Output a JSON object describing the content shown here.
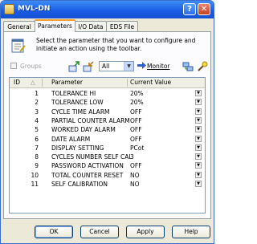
{
  "window": {
    "title": "MVL-DN",
    "help_btn": "?",
    "close_btn": "✕"
  },
  "tabs": [
    "General",
    "Parameters",
    "I/O Data",
    "EDS File"
  ],
  "active_tab": "Parameters",
  "info_text": "Select the parameter that you want to configure and initiate an action using the toolbar.",
  "toolbar": {
    "groups_label": "Groups",
    "filter_value": "All",
    "monitor_label": "Monitor"
  },
  "grid": {
    "columns": [
      "ID",
      "Parameter",
      "Current Value"
    ],
    "rows": [
      {
        "id": "1",
        "param": "TOLERANCE HI",
        "value": "20%"
      },
      {
        "id": "2",
        "param": "TOLERANCE LOW",
        "value": "20%"
      },
      {
        "id": "3",
        "param": "CYCLE TIME ALARM",
        "value": "OFF"
      },
      {
        "id": "4",
        "param": "PARTIAL COUNTER ALARM",
        "value": "OFF"
      },
      {
        "id": "5",
        "param": "WORKED DAY ALARM",
        "value": "OFF"
      },
      {
        "id": "6",
        "param": "DATE ALARM",
        "value": "OFF"
      },
      {
        "id": "7",
        "param": "DISPLAY SETTING",
        "value": "PCot"
      },
      {
        "id": "8",
        "param": "CYCLES NUMBER SELF CAL",
        "value": "3"
      },
      {
        "id": "9",
        "param": "PASSWORD ACTIVATION",
        "value": "OFF"
      },
      {
        "id": "10",
        "param": "TOTAL COUNTER RESET",
        "value": "NO"
      },
      {
        "id": "11",
        "param": "SELF CALIBRATION",
        "value": "NO"
      }
    ]
  },
  "buttons": {
    "ok": "OK",
    "cancel": "Cancel",
    "apply": "Apply",
    "help": "Help"
  }
}
